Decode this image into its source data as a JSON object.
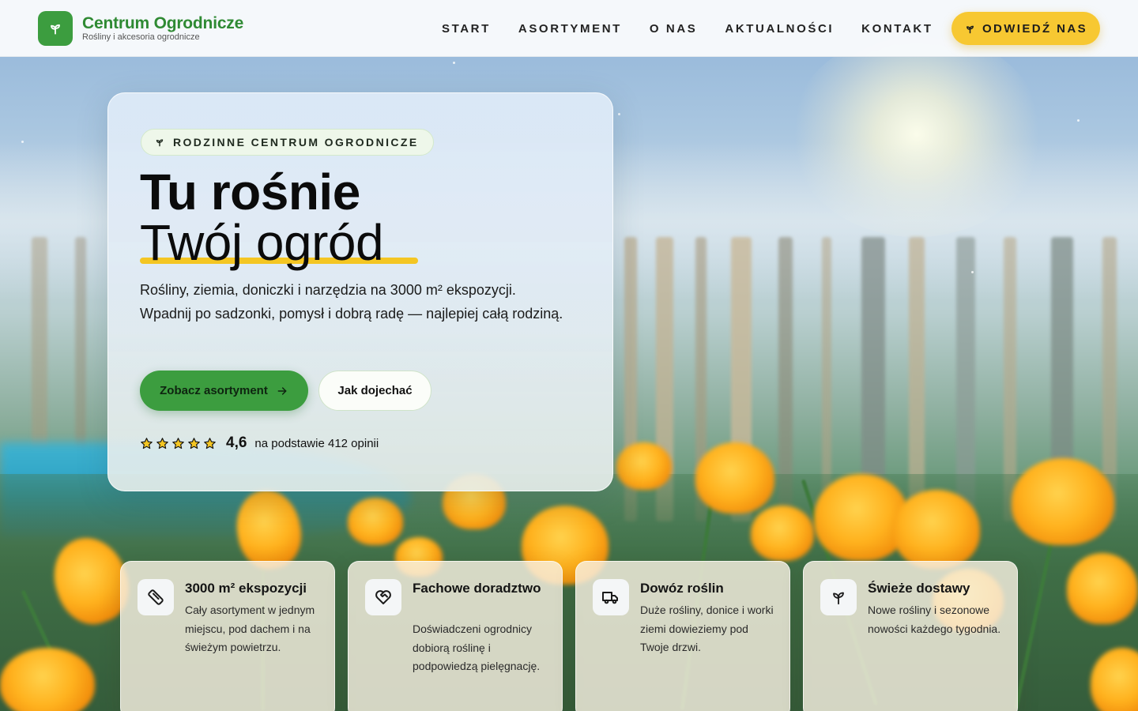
{
  "brand": {
    "name": "Centrum Ogrodnicze",
    "tagline": "Rośliny i akcesoria ogrodnicze",
    "accent": "#3c9d3f",
    "highlight": "#f7c832"
  },
  "nav": {
    "items": [
      {
        "label": "START"
      },
      {
        "label": "ASORTYMENT"
      },
      {
        "label": "O NAS"
      },
      {
        "label": "AKTUALNOŚCI"
      },
      {
        "label": "KONTAKT"
      }
    ],
    "cta_label": "ODWIEDŹ NAS"
  },
  "hero": {
    "badge": "RODZINNE CENTRUM OGRODNICZE",
    "title_line1": "Tu rośnie",
    "title_line2": "Twój ogród",
    "lead": "Rośliny, ziemia, doniczki i narzędzia na 3000 m² ekspozycji. Wpadnij po sadzonki, pomysł i dobrą radę — najlepiej całą rodziną.",
    "primary_button": "Zobacz asortyment",
    "secondary_button": "Jak dojechać",
    "rating": {
      "stars": 5,
      "value": "4,6",
      "text": "na podstawie 412 opinii"
    }
  },
  "features": [
    {
      "icon": "ruler-icon",
      "title": "3000 m² ekspozycji",
      "text": "Cały asortyment w jednym miejscu, pod dachem i na świeżym powietrzu."
    },
    {
      "icon": "heart-handshake-icon",
      "title": "Fachowe doradztwo",
      "text": "Doświadczeni ogrodnicy dobiorą roślinę i podpowiedzą pielęgnację."
    },
    {
      "icon": "truck-icon",
      "title": "Dowóz roślin",
      "text": "Duże rośliny, donice i worki ziemi dowieziemy pod Twoje drzwi."
    },
    {
      "icon": "sprout-icon",
      "title": "Świeże dostawy",
      "text": "Nowe rośliny i sezonowe nowości każdego tygodnia."
    }
  ]
}
